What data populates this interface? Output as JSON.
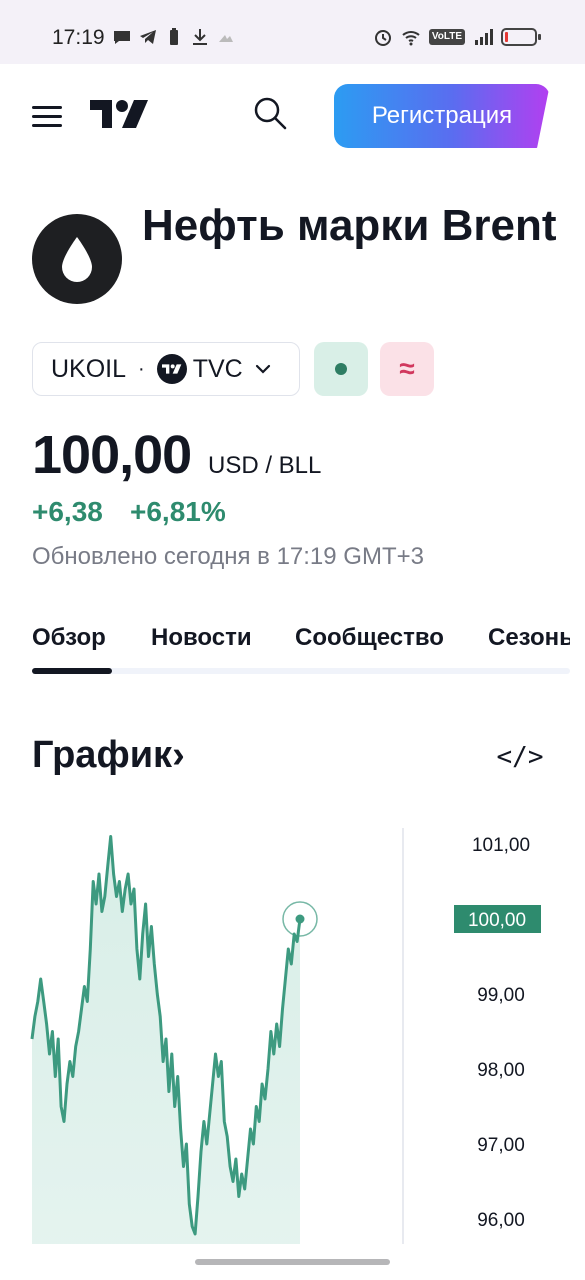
{
  "status_bar": {
    "time": "17:19",
    "volte": "VoLTE",
    "battery_level": 0.1
  },
  "header": {
    "register_label": "Регистрация"
  },
  "symbol": {
    "title": "Нефть марки Brent",
    "ticker": "UKOIL",
    "separator": "·",
    "exchange": "TVC",
    "delay_glyph": "≈"
  },
  "quote": {
    "price": "100,00",
    "currency": "USD / BLL",
    "change_abs": "+6,38",
    "change_pct": "+6,81%",
    "updated": "Обновлено сегодня в 17:19 GMT+3"
  },
  "tabs": [
    {
      "label": "Обзор",
      "active": true
    },
    {
      "label": "Новости",
      "active": false
    },
    {
      "label": "Сообщество",
      "active": false
    },
    {
      "label": "Сезоны",
      "active": false
    }
  ],
  "chart_section": {
    "title": "График",
    "arrow": "›",
    "embed_label": "</>"
  },
  "colors": {
    "accent_green": "#2e8b6e",
    "line_color": "#3d9a80",
    "fill_color": "#d6ede6",
    "price_tag_bg": "#2e8b6e"
  },
  "chart_data": {
    "type": "area",
    "ylim": [
      95.7,
      101.5
    ],
    "y_ticks": [
      "101,00",
      "100,00",
      "99,00",
      "98,00",
      "97,00",
      "96,00"
    ],
    "y_tick_values": [
      101,
      100,
      99,
      98,
      97,
      96
    ],
    "current_label": "100,00",
    "current_value": 100.0,
    "values": [
      98.4,
      98.7,
      98.9,
      99.2,
      98.9,
      98.6,
      98.2,
      98.5,
      97.9,
      98.4,
      97.5,
      97.3,
      97.8,
      98.1,
      97.9,
      98.3,
      98.5,
      98.8,
      99.1,
      98.9,
      99.6,
      100.5,
      100.2,
      100.6,
      100.1,
      100.3,
      100.7,
      101.1,
      100.6,
      100.3,
      100.5,
      100.1,
      100.4,
      100.6,
      100.2,
      100.4,
      99.6,
      99.2,
      99.8,
      100.2,
      99.5,
      99.9,
      99.4,
      99.0,
      98.7,
      98.1,
      98.4,
      97.7,
      98.2,
      97.5,
      97.9,
      97.2,
      96.7,
      97.0,
      96.2,
      95.9,
      95.8,
      96.3,
      96.9,
      97.3,
      97.0,
      97.4,
      97.8,
      98.2,
      97.9,
      98.1,
      97.3,
      97.1,
      96.7,
      96.5,
      96.8,
      96.3,
      96.6,
      96.4,
      96.8,
      97.2,
      97.0,
      97.5,
      97.3,
      97.8,
      97.6,
      98.0,
      98.5,
      98.2,
      98.6,
      98.3,
      98.8,
      99.2,
      99.6,
      99.4,
      99.8,
      99.7,
      100.0
    ]
  }
}
